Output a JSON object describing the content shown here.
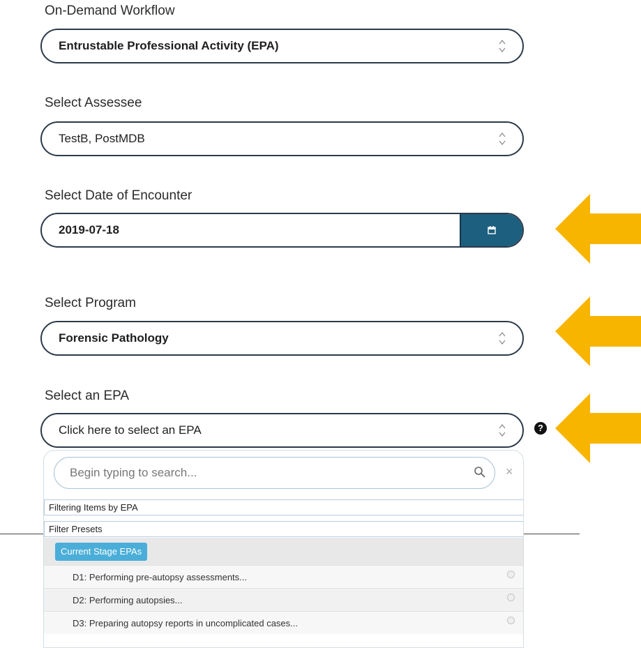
{
  "workflow": {
    "label": "On-Demand Workflow",
    "value": "Entrustable Professional Activity (EPA)"
  },
  "assessee": {
    "label": "Select Assessee",
    "value": "TestB, PostMDB"
  },
  "date": {
    "label": "Select Date of Encounter",
    "value": "2019-07-18"
  },
  "program": {
    "label": "Select Program",
    "value": "Forensic Pathology"
  },
  "epa": {
    "label": "Select an EPA",
    "placeholder": "Click here to select an EPA",
    "help": "?"
  },
  "dropdown": {
    "search_placeholder": "Begin typing to search...",
    "clear": "×",
    "filter_heading": "Filtering Items by EPA",
    "presets_heading": "Filter Presets",
    "preset_chip": "Current Stage EPAs",
    "items": [
      {
        "label": "D1: Performing pre-autopsy assessments..."
      },
      {
        "label": "D2: Performing autopsies..."
      },
      {
        "label": "D3: Preparing autopsy reports in uncomplicated cases..."
      }
    ]
  },
  "colors": {
    "accent": "#1c5f7f",
    "arrow": "#f7b500",
    "chip": "#4aaed8"
  },
  "icons": [
    "chevron-updown-icon",
    "calendar-icon",
    "search-icon",
    "help-icon",
    "arrow-left-icon"
  ]
}
